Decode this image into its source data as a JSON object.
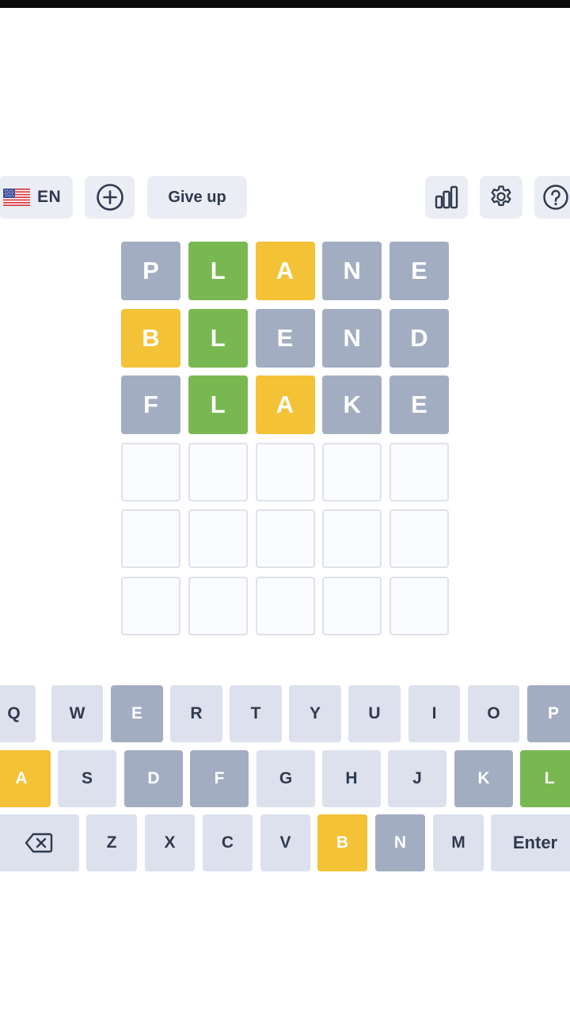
{
  "toolbar": {
    "language_code": "EN",
    "flag_icon": "us-flag-icon",
    "add_icon": "plus-circle-icon",
    "give_up_label": "Give up",
    "stats_icon": "bar-chart-icon",
    "settings_icon": "gear-icon",
    "help_icon": "question-circle-icon"
  },
  "colors": {
    "correct": "#79b851",
    "present": "#f3c237",
    "absent": "#a3adc2",
    "key_default": "#dce1ed",
    "empty_border": "#dee1e9"
  },
  "board": {
    "rows": [
      [
        {
          "letter": "P",
          "state": "absent"
        },
        {
          "letter": "L",
          "state": "correct"
        },
        {
          "letter": "A",
          "state": "present"
        },
        {
          "letter": "N",
          "state": "absent"
        },
        {
          "letter": "E",
          "state": "absent"
        }
      ],
      [
        {
          "letter": "B",
          "state": "present"
        },
        {
          "letter": "L",
          "state": "correct"
        },
        {
          "letter": "E",
          "state": "absent"
        },
        {
          "letter": "N",
          "state": "absent"
        },
        {
          "letter": "D",
          "state": "absent"
        }
      ],
      [
        {
          "letter": "F",
          "state": "absent"
        },
        {
          "letter": "L",
          "state": "correct"
        },
        {
          "letter": "A",
          "state": "present"
        },
        {
          "letter": "K",
          "state": "absent"
        },
        {
          "letter": "E",
          "state": "absent"
        }
      ],
      [
        {
          "letter": "",
          "state": "empty"
        },
        {
          "letter": "",
          "state": "empty"
        },
        {
          "letter": "",
          "state": "empty"
        },
        {
          "letter": "",
          "state": "empty"
        },
        {
          "letter": "",
          "state": "empty"
        }
      ],
      [
        {
          "letter": "",
          "state": "empty"
        },
        {
          "letter": "",
          "state": "empty"
        },
        {
          "letter": "",
          "state": "empty"
        },
        {
          "letter": "",
          "state": "empty"
        },
        {
          "letter": "",
          "state": "empty"
        }
      ],
      [
        {
          "letter": "",
          "state": "empty"
        },
        {
          "letter": "",
          "state": "empty"
        },
        {
          "letter": "",
          "state": "empty"
        },
        {
          "letter": "",
          "state": "empty"
        },
        {
          "letter": "",
          "state": "empty"
        }
      ]
    ]
  },
  "keyboard": {
    "row1": [
      {
        "label": "Q",
        "state": "default"
      },
      {
        "label": "W",
        "state": "default"
      },
      {
        "label": "E",
        "state": "absent"
      },
      {
        "label": "R",
        "state": "default"
      },
      {
        "label": "T",
        "state": "default"
      },
      {
        "label": "Y",
        "state": "default"
      },
      {
        "label": "U",
        "state": "default"
      },
      {
        "label": "I",
        "state": "default"
      },
      {
        "label": "O",
        "state": "default"
      },
      {
        "label": "P",
        "state": "absent"
      }
    ],
    "row2": [
      {
        "label": "A",
        "state": "present"
      },
      {
        "label": "S",
        "state": "default"
      },
      {
        "label": "D",
        "state": "absent"
      },
      {
        "label": "F",
        "state": "absent"
      },
      {
        "label": "G",
        "state": "default"
      },
      {
        "label": "H",
        "state": "default"
      },
      {
        "label": "J",
        "state": "default"
      },
      {
        "label": "K",
        "state": "absent"
      },
      {
        "label": "L",
        "state": "correct"
      }
    ],
    "row3": [
      {
        "label": "",
        "icon": "backspace-icon",
        "state": "default"
      },
      {
        "label": "Z",
        "state": "default"
      },
      {
        "label": "X",
        "state": "default"
      },
      {
        "label": "C",
        "state": "default"
      },
      {
        "label": "V",
        "state": "default"
      },
      {
        "label": "B",
        "state": "present"
      },
      {
        "label": "N",
        "state": "absent"
      },
      {
        "label": "M",
        "state": "default"
      },
      {
        "label": "Enter",
        "state": "default"
      }
    ]
  }
}
